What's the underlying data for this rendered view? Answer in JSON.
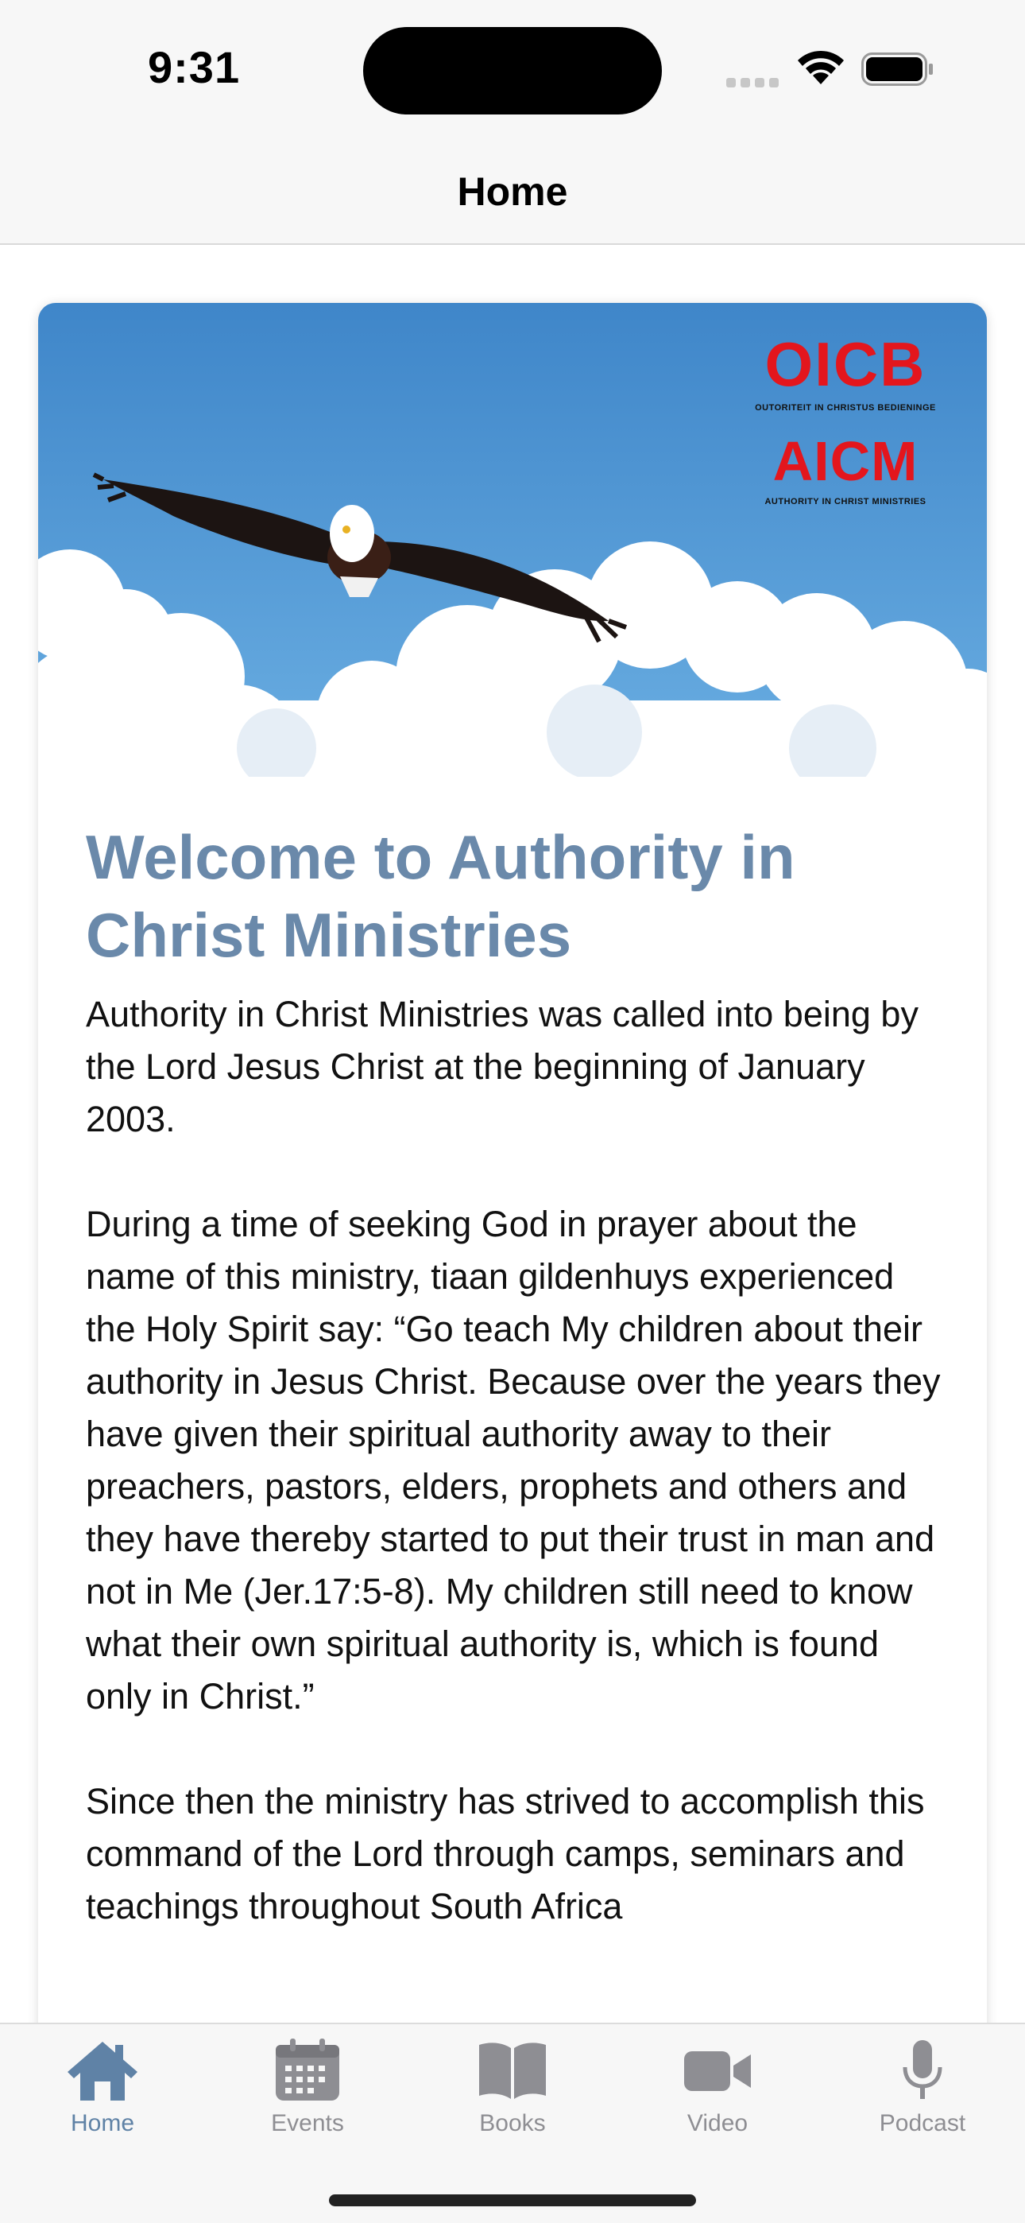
{
  "status_bar": {
    "time": "9:31"
  },
  "nav": {
    "title": "Home"
  },
  "card": {
    "logo": {
      "line1": "OICB",
      "line1_sub": "OUTORITEIT IN CHRISTUS BEDIENINGE",
      "line2": "AICM",
      "line2_sub": "AUTHORITY IN CHRIST MINISTRIES"
    },
    "title": "Welcome to Authority in Christ Ministries",
    "paragraphs": [
      "Authority in Christ Ministries was called into being by the Lord Jesus Christ at the beginning of January 2003.",
      "During a time of seeking God in prayer about the name of this ministry, tiaan gildenhuys experienced the Holy Spirit say: “Go teach My children about their authority in Jesus Christ. Because over the years they have given their spiritual authority away to their preachers, pastors, elders, prophets and others and they have thereby started to put their trust in man and not in Me (Jer.17:5-8). My children still need to know what their own spiritual authority is, which is found only in Christ.”",
      "Since then the ministry has strived to accomplish this command of the Lord through camps, seminars and teachings throughout South Africa"
    ]
  },
  "tabs": [
    {
      "label": "Home",
      "icon": "house-icon",
      "active": true
    },
    {
      "label": "Events",
      "icon": "calendar-icon",
      "active": false
    },
    {
      "label": "Books",
      "icon": "book-icon",
      "active": false
    },
    {
      "label": "Video",
      "icon": "video-camera-icon",
      "active": false
    },
    {
      "label": "Podcast",
      "icon": "microphone-icon",
      "active": false
    }
  ],
  "colors": {
    "accent": "#5f82a6",
    "title": "#6a89aa",
    "inactive_tab": "#8e8e93",
    "logo_red": "#e3161d"
  }
}
